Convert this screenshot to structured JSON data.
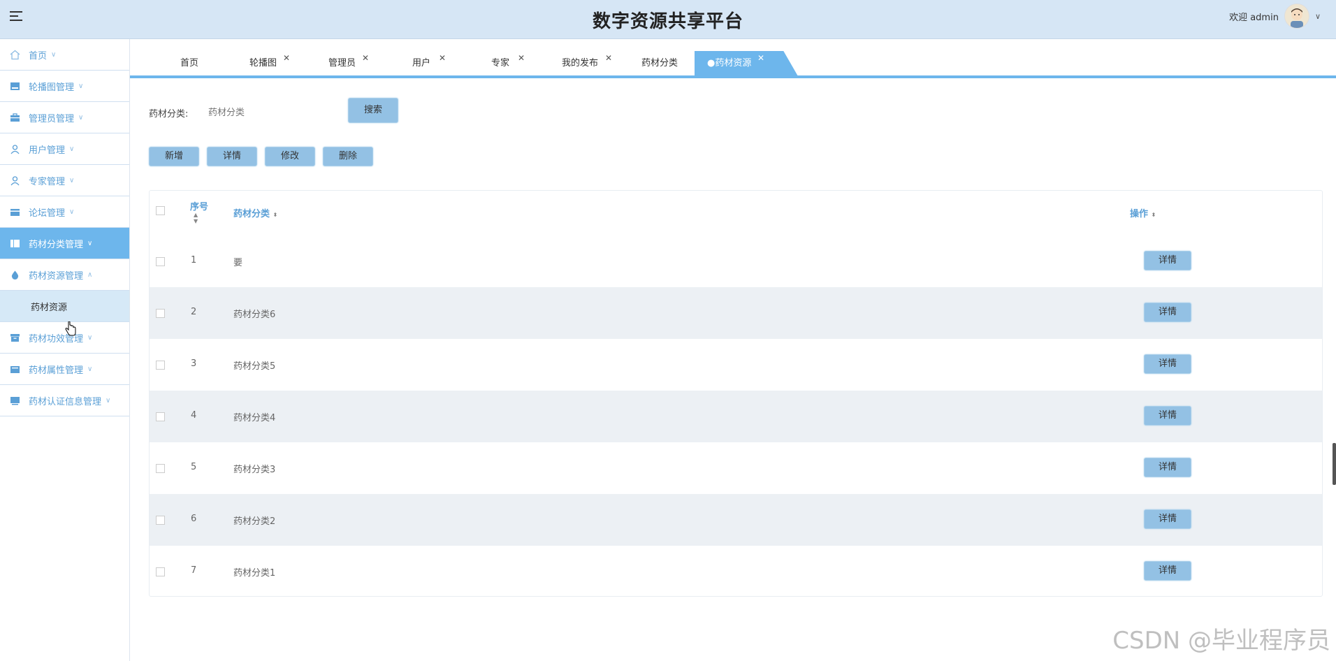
{
  "app": {
    "title": "数字资源共享平台"
  },
  "header": {
    "welcome": "欢迎 admin"
  },
  "sidebar": {
    "items": [
      {
        "label": "首页",
        "icon": "home-icon"
      },
      {
        "label": "轮播图管理",
        "icon": "image-icon"
      },
      {
        "label": "管理员管理",
        "icon": "briefcase-icon"
      },
      {
        "label": "用户管理",
        "icon": "user-icon"
      },
      {
        "label": "专家管理",
        "icon": "user-icon"
      },
      {
        "label": "论坛管理",
        "icon": "card-icon"
      },
      {
        "label": "药材分类管理",
        "icon": "columns-icon",
        "active": true
      },
      {
        "label": "药材资源管理",
        "icon": "drop-icon",
        "expanded": true
      },
      {
        "label": "药材功效管理",
        "icon": "box-icon"
      },
      {
        "label": "药材属性管理",
        "icon": "folder-icon"
      },
      {
        "label": "药材认证信息管理",
        "icon": "monitor-icon"
      }
    ],
    "subitem": "药材资源"
  },
  "tabs": [
    {
      "label": "首页"
    },
    {
      "label": "轮播图"
    },
    {
      "label": "管理员"
    },
    {
      "label": "用户"
    },
    {
      "label": "专家"
    },
    {
      "label": "我的发布"
    },
    {
      "label": "药材分类"
    },
    {
      "label": "●药材资源",
      "active": true
    }
  ],
  "search": {
    "label": "药材分类:",
    "placeholder": "药材分类",
    "button": "搜索"
  },
  "actions": {
    "add": "新增",
    "detail": "详情",
    "edit": "修改",
    "delete": "删除"
  },
  "table": {
    "headers": {
      "index": "序号",
      "category": "药材分类",
      "ops": "操作"
    },
    "rows": [
      {
        "index": "1",
        "category": "要",
        "action": "详情"
      },
      {
        "index": "2",
        "category": "药材分类6",
        "action": "详情"
      },
      {
        "index": "3",
        "category": "药材分类5",
        "action": "详情"
      },
      {
        "index": "4",
        "category": "药材分类4",
        "action": "详情"
      },
      {
        "index": "5",
        "category": "药材分类3",
        "action": "详情"
      },
      {
        "index": "6",
        "category": "药材分类2",
        "action": "详情"
      },
      {
        "index": "7",
        "category": "药材分类1",
        "action": "详情"
      }
    ]
  },
  "watermark": "CSDN @毕业程序员",
  "colors": {
    "accent": "#6db6ec",
    "button": "#93c1e4",
    "header_bg": "#d6e6f5",
    "sidebar_text": "#5a9fd6"
  }
}
